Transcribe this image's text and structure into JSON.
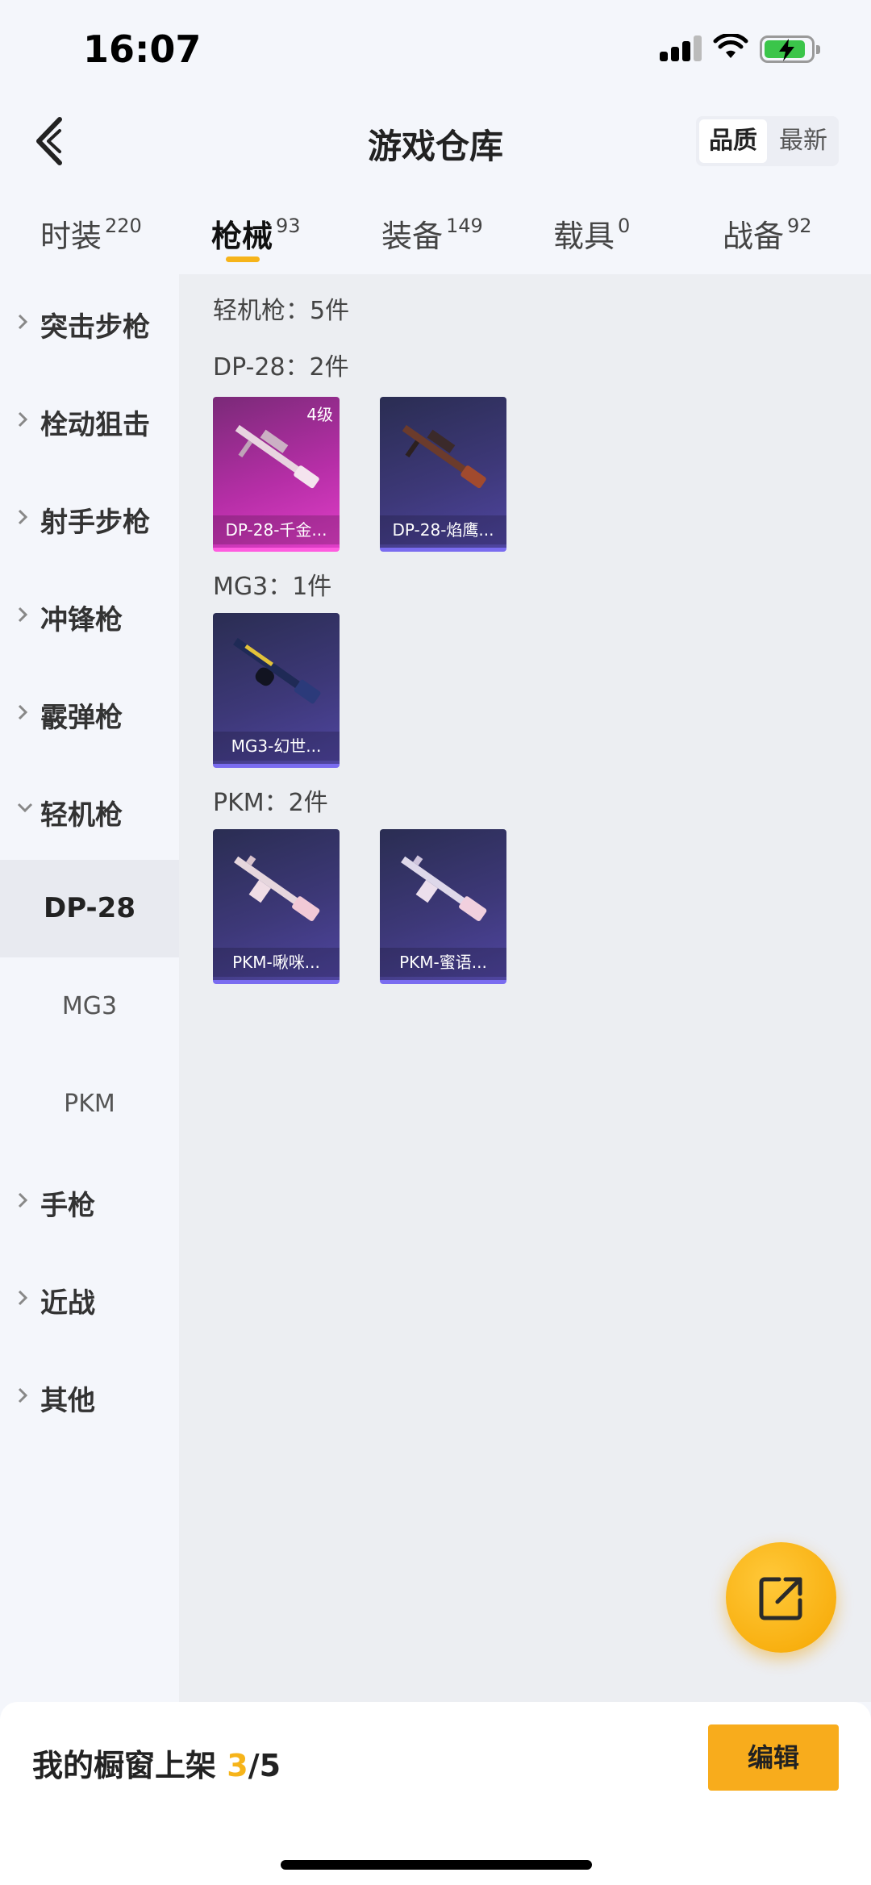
{
  "status_bar": {
    "time": "16:07"
  },
  "header": {
    "title": "游戏仓库",
    "sort_options": [
      "品质",
      "最新"
    ]
  },
  "tabs": [
    {
      "label": "时装",
      "count": "220"
    },
    {
      "label": "枪械",
      "count": "93"
    },
    {
      "label": "装备",
      "count": "149"
    },
    {
      "label": "载具",
      "count": "0"
    },
    {
      "label": "战备",
      "count": "92"
    }
  ],
  "sidebar": {
    "categories": [
      "突击步枪",
      "栓动狙击",
      "射手步枪",
      "冲锋枪",
      "霰弹枪",
      "轻机枪"
    ],
    "subitems": [
      "DP-28",
      "MG3",
      "PKM"
    ],
    "more_categories": [
      "手枪",
      "近战",
      "其他"
    ]
  },
  "main": {
    "summary": "轻机枪：5件",
    "groups": [
      {
        "title": "DP-28：2件",
        "items": [
          {
            "name": "DP-28-千金...",
            "level": "4级"
          },
          {
            "name": "DP-28-焰鹰..."
          }
        ]
      },
      {
        "title": "MG3：1件",
        "items": [
          {
            "name": "MG3-幻世..."
          }
        ]
      },
      {
        "title": "PKM：2件",
        "items": [
          {
            "name": "PKM-啾咪..."
          },
          {
            "name": "PKM-蜜语..."
          }
        ]
      }
    ]
  },
  "bottom": {
    "showcase_prefix": "我的橱窗上架 ",
    "showcase_current": "3",
    "showcase_total": "/5",
    "edit_label": "编辑"
  },
  "colors": {
    "accent": "#f6b41a",
    "card_purple": "#3d3878",
    "card_pink": "#b52ea6"
  }
}
